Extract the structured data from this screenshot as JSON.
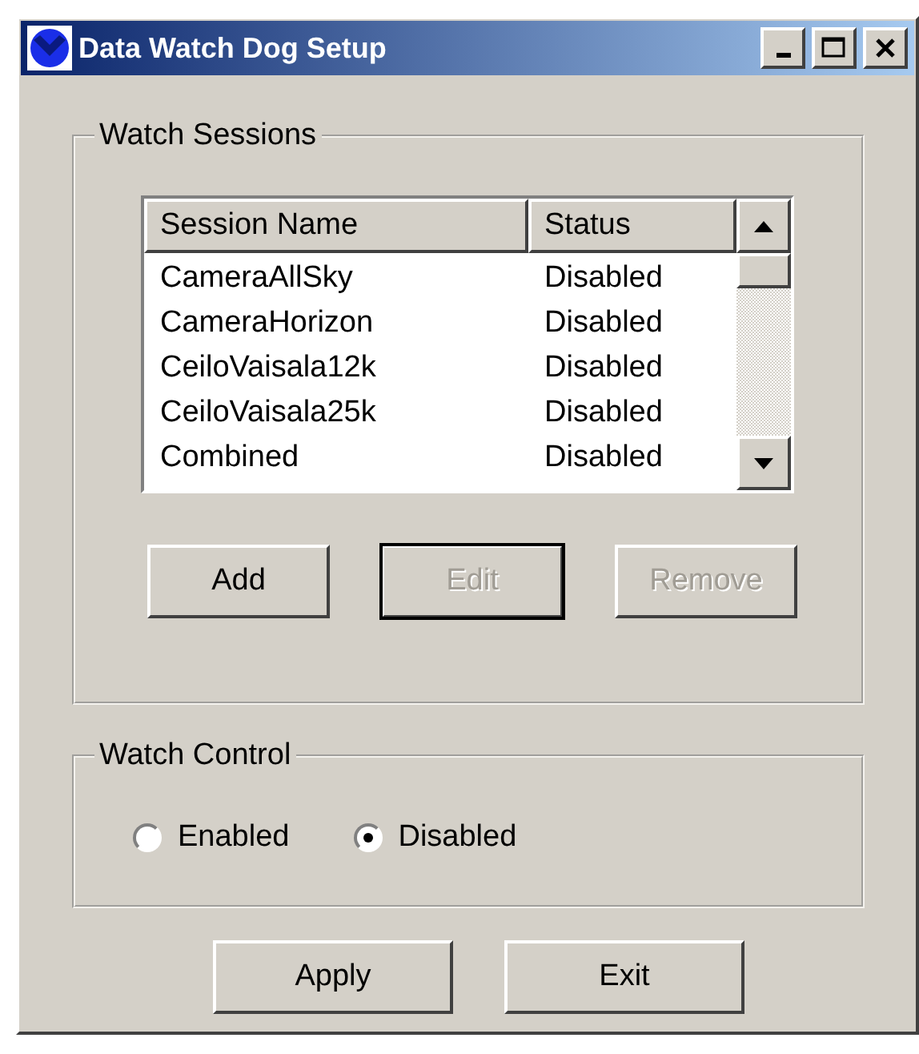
{
  "window": {
    "title": "Data Watch Dog Setup"
  },
  "watch_sessions": {
    "title": "Watch Sessions",
    "columns": [
      "Session Name",
      "Status"
    ],
    "rows": [
      {
        "name": "CameraAllSky",
        "status": "Disabled"
      },
      {
        "name": "CameraHorizon",
        "status": "Disabled"
      },
      {
        "name": "CeiloVaisala12k",
        "status": "Disabled"
      },
      {
        "name": "CeiloVaisala25k",
        "status": "Disabled"
      },
      {
        "name": "Combined",
        "status": "Disabled"
      }
    ],
    "buttons": [
      {
        "label": "Add",
        "disabled": false,
        "default": false
      },
      {
        "label": "Edit",
        "disabled": true,
        "default": true
      },
      {
        "label": "Remove",
        "disabled": true,
        "default": false
      }
    ]
  },
  "watch_control": {
    "title": "Watch Control",
    "options": [
      {
        "label": "Enabled",
        "selected": false
      },
      {
        "label": "Disabled",
        "selected": true
      }
    ]
  },
  "buttons": [
    {
      "label": "Apply"
    },
    {
      "label": "Exit"
    }
  ]
}
